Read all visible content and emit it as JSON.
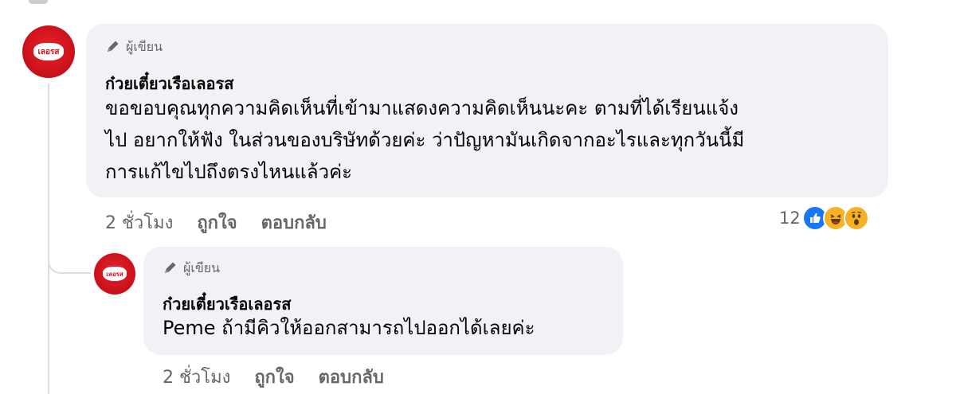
{
  "comment": {
    "author_badge": "ผู้เขียน",
    "author_name": "ก๋วยเตี๋ยวเรือเลอรส",
    "text_lines": [
      "ขอขอบคุณทุกความคิดเห็นที่เข้ามาแสดงความคิดเห็นนะคะ ตามที่ได้เรียนแจ้ง",
      "ไป อยากให้ฟัง ในส่วนของบริษัทด้วยค่ะ ว่าปัญหามันเกิดจากอะไรและทุกวันนี้มี",
      "การแก้ไขไปถึงตรงไหนแล้วค่ะ"
    ],
    "time": "2 ชั่วโมง",
    "like_label": "ถูกใจ",
    "reply_label": "ตอบกลับ",
    "reaction_count": "12",
    "reactions": [
      "like-icon",
      "haha-icon",
      "wow-icon"
    ],
    "avatar_logo": "เลอรส"
  },
  "reply": {
    "author_badge": "ผู้เขียน",
    "author_name": "ก๋วยเตี๋ยวเรือเลอรส",
    "text": "Peme ถ้ามีคิวให้ออกสามารถไปออกได้เลยค่ะ",
    "time": "2 ชั่วโมง",
    "like_label": "ถูกใจ",
    "reply_label": "ตอบกลับ",
    "avatar_logo": "เลอรส"
  },
  "colors": {
    "bubble": "#f0f2f5",
    "secondary_text": "#65676b",
    "avatar_red": "#d0141c",
    "like_blue": "#1877f2"
  }
}
